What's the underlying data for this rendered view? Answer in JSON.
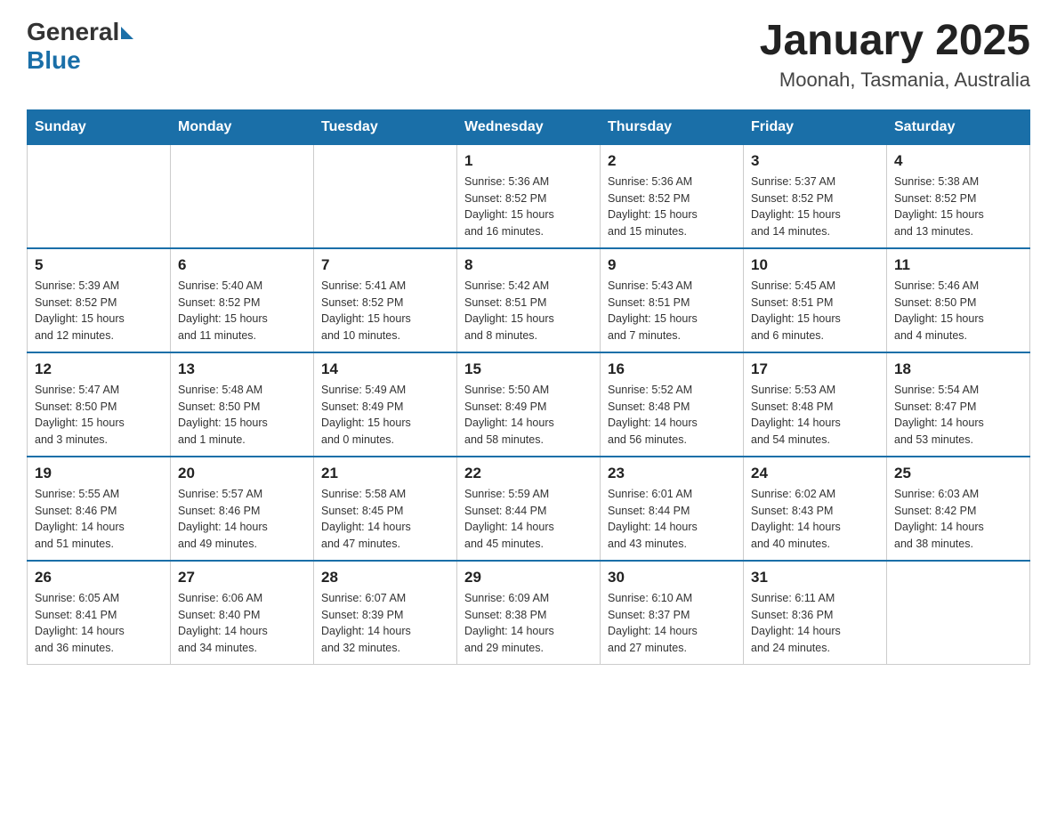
{
  "header": {
    "logo_text_general": "General",
    "logo_text_blue": "Blue",
    "title": "January 2025",
    "subtitle": "Moonah, Tasmania, Australia"
  },
  "days_of_week": [
    "Sunday",
    "Monday",
    "Tuesday",
    "Wednesday",
    "Thursday",
    "Friday",
    "Saturday"
  ],
  "weeks": [
    [
      {
        "day": "",
        "info": ""
      },
      {
        "day": "",
        "info": ""
      },
      {
        "day": "",
        "info": ""
      },
      {
        "day": "1",
        "info": "Sunrise: 5:36 AM\nSunset: 8:52 PM\nDaylight: 15 hours\nand 16 minutes."
      },
      {
        "day": "2",
        "info": "Sunrise: 5:36 AM\nSunset: 8:52 PM\nDaylight: 15 hours\nand 15 minutes."
      },
      {
        "day": "3",
        "info": "Sunrise: 5:37 AM\nSunset: 8:52 PM\nDaylight: 15 hours\nand 14 minutes."
      },
      {
        "day": "4",
        "info": "Sunrise: 5:38 AM\nSunset: 8:52 PM\nDaylight: 15 hours\nand 13 minutes."
      }
    ],
    [
      {
        "day": "5",
        "info": "Sunrise: 5:39 AM\nSunset: 8:52 PM\nDaylight: 15 hours\nand 12 minutes."
      },
      {
        "day": "6",
        "info": "Sunrise: 5:40 AM\nSunset: 8:52 PM\nDaylight: 15 hours\nand 11 minutes."
      },
      {
        "day": "7",
        "info": "Sunrise: 5:41 AM\nSunset: 8:52 PM\nDaylight: 15 hours\nand 10 minutes."
      },
      {
        "day": "8",
        "info": "Sunrise: 5:42 AM\nSunset: 8:51 PM\nDaylight: 15 hours\nand 8 minutes."
      },
      {
        "day": "9",
        "info": "Sunrise: 5:43 AM\nSunset: 8:51 PM\nDaylight: 15 hours\nand 7 minutes."
      },
      {
        "day": "10",
        "info": "Sunrise: 5:45 AM\nSunset: 8:51 PM\nDaylight: 15 hours\nand 6 minutes."
      },
      {
        "day": "11",
        "info": "Sunrise: 5:46 AM\nSunset: 8:50 PM\nDaylight: 15 hours\nand 4 minutes."
      }
    ],
    [
      {
        "day": "12",
        "info": "Sunrise: 5:47 AM\nSunset: 8:50 PM\nDaylight: 15 hours\nand 3 minutes."
      },
      {
        "day": "13",
        "info": "Sunrise: 5:48 AM\nSunset: 8:50 PM\nDaylight: 15 hours\nand 1 minute."
      },
      {
        "day": "14",
        "info": "Sunrise: 5:49 AM\nSunset: 8:49 PM\nDaylight: 15 hours\nand 0 minutes."
      },
      {
        "day": "15",
        "info": "Sunrise: 5:50 AM\nSunset: 8:49 PM\nDaylight: 14 hours\nand 58 minutes."
      },
      {
        "day": "16",
        "info": "Sunrise: 5:52 AM\nSunset: 8:48 PM\nDaylight: 14 hours\nand 56 minutes."
      },
      {
        "day": "17",
        "info": "Sunrise: 5:53 AM\nSunset: 8:48 PM\nDaylight: 14 hours\nand 54 minutes."
      },
      {
        "day": "18",
        "info": "Sunrise: 5:54 AM\nSunset: 8:47 PM\nDaylight: 14 hours\nand 53 minutes."
      }
    ],
    [
      {
        "day": "19",
        "info": "Sunrise: 5:55 AM\nSunset: 8:46 PM\nDaylight: 14 hours\nand 51 minutes."
      },
      {
        "day": "20",
        "info": "Sunrise: 5:57 AM\nSunset: 8:46 PM\nDaylight: 14 hours\nand 49 minutes."
      },
      {
        "day": "21",
        "info": "Sunrise: 5:58 AM\nSunset: 8:45 PM\nDaylight: 14 hours\nand 47 minutes."
      },
      {
        "day": "22",
        "info": "Sunrise: 5:59 AM\nSunset: 8:44 PM\nDaylight: 14 hours\nand 45 minutes."
      },
      {
        "day": "23",
        "info": "Sunrise: 6:01 AM\nSunset: 8:44 PM\nDaylight: 14 hours\nand 43 minutes."
      },
      {
        "day": "24",
        "info": "Sunrise: 6:02 AM\nSunset: 8:43 PM\nDaylight: 14 hours\nand 40 minutes."
      },
      {
        "day": "25",
        "info": "Sunrise: 6:03 AM\nSunset: 8:42 PM\nDaylight: 14 hours\nand 38 minutes."
      }
    ],
    [
      {
        "day": "26",
        "info": "Sunrise: 6:05 AM\nSunset: 8:41 PM\nDaylight: 14 hours\nand 36 minutes."
      },
      {
        "day": "27",
        "info": "Sunrise: 6:06 AM\nSunset: 8:40 PM\nDaylight: 14 hours\nand 34 minutes."
      },
      {
        "day": "28",
        "info": "Sunrise: 6:07 AM\nSunset: 8:39 PM\nDaylight: 14 hours\nand 32 minutes."
      },
      {
        "day": "29",
        "info": "Sunrise: 6:09 AM\nSunset: 8:38 PM\nDaylight: 14 hours\nand 29 minutes."
      },
      {
        "day": "30",
        "info": "Sunrise: 6:10 AM\nSunset: 8:37 PM\nDaylight: 14 hours\nand 27 minutes."
      },
      {
        "day": "31",
        "info": "Sunrise: 6:11 AM\nSunset: 8:36 PM\nDaylight: 14 hours\nand 24 minutes."
      },
      {
        "day": "",
        "info": ""
      }
    ]
  ]
}
